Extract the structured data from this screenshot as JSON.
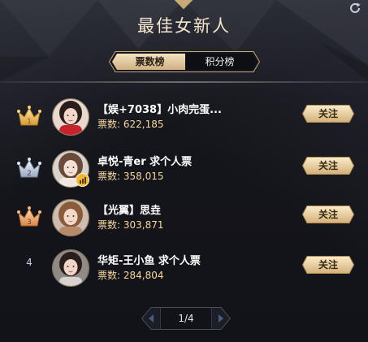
{
  "header": {
    "title": "最佳女新人"
  },
  "tabs": [
    {
      "label": "票数榜",
      "active": true
    },
    {
      "label": "积分榜",
      "active": false
    }
  ],
  "ranking": [
    {
      "rank": "1",
      "name": "【娱+7038】小肉完蛋...",
      "votes_label": "票数:",
      "votes": "622,185",
      "follow_label": "关注",
      "crown": "gold"
    },
    {
      "rank": "2",
      "name": "卓悦-青er 求个人票",
      "votes_label": "票数:",
      "votes": "358,015",
      "follow_label": "关注",
      "crown": "silver"
    },
    {
      "rank": "3",
      "name": "【光翼】思垚",
      "votes_label": "票数:",
      "votes": "303,871",
      "follow_label": "关注",
      "crown": "bronze"
    },
    {
      "rank": "4",
      "name": "华矩-王小鱼 求个人票",
      "votes_label": "票数:",
      "votes": "284,804",
      "follow_label": "关注",
      "crown": "none"
    }
  ],
  "pagination": {
    "text": "1/4"
  },
  "colors": {
    "gold_accent": "#c9a877",
    "votes_text": "#f6d79f",
    "background": "#121319"
  },
  "icons": [
    "refresh-icon",
    "crown-gold-icon",
    "crown-silver-icon",
    "crown-bronze-icon",
    "level-badge-icon",
    "chevron-left-icon",
    "chevron-right-icon"
  ]
}
